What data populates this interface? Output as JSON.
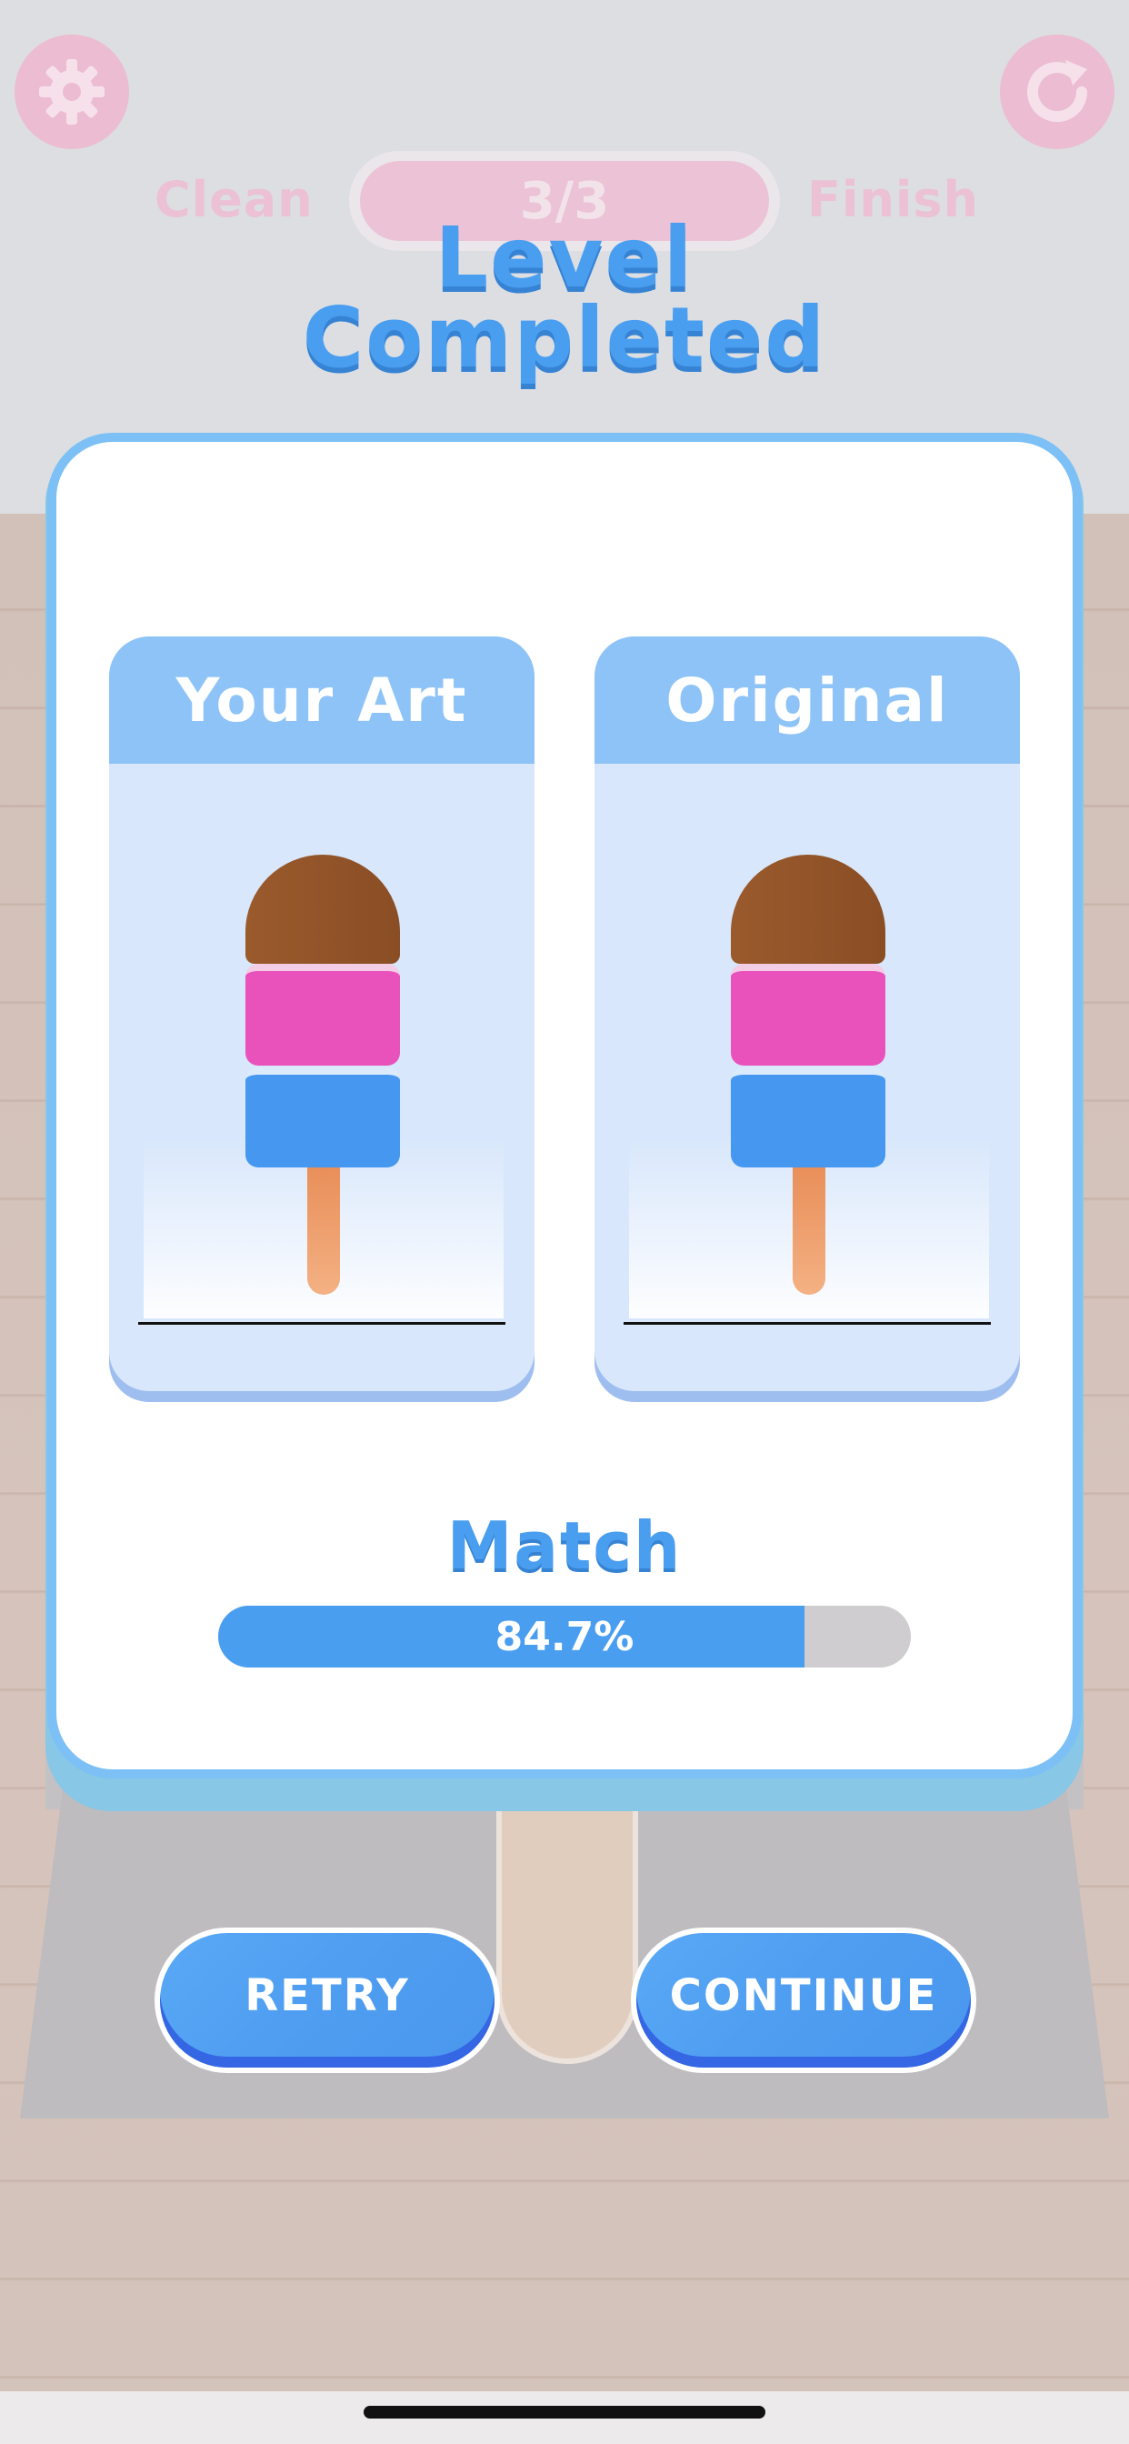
{
  "hud": {
    "settings_icon": "gear-icon",
    "restart_icon": "restart-icon",
    "step_left": "Clean",
    "step_right": "Finish",
    "progress": "3/3"
  },
  "title": {
    "line1": "Level",
    "line2": "Completed"
  },
  "comparison": {
    "left_label": "Your Art",
    "right_label": "Original"
  },
  "match": {
    "label": "Match",
    "percent_text": "84.7%",
    "percent_value": 84.7
  },
  "buttons": {
    "retry": "RETRY",
    "continue": "CONTINUE"
  },
  "colors": {
    "accent": "#4a9ef0",
    "popsicle_top": "#8a4e25",
    "popsicle_middle": "#ea52bb",
    "popsicle_bottom": "#4597f0",
    "popsicle_stick": "#f4b183"
  }
}
